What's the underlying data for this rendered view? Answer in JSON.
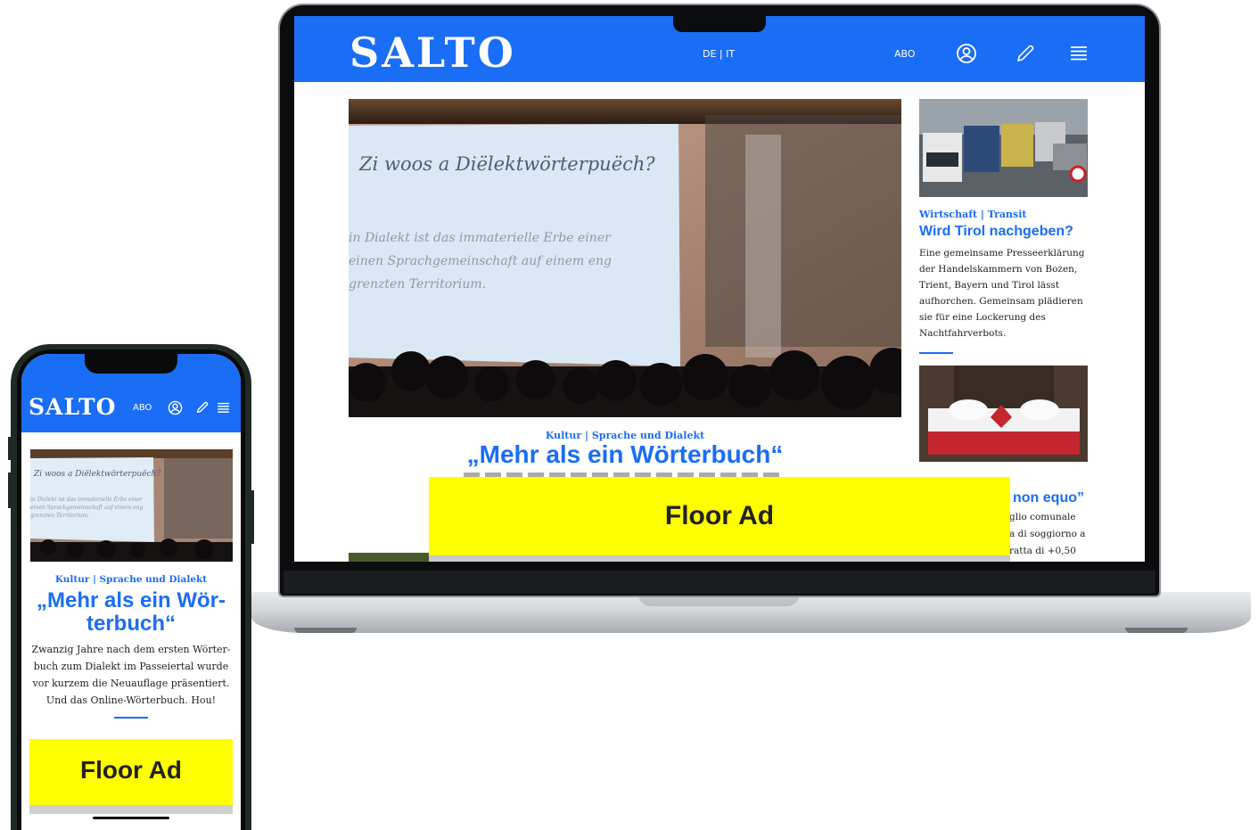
{
  "laptop": {
    "header": {
      "logo": "SALTO",
      "lang_switch": "DE | IT",
      "abo_label": "ABO",
      "icons": [
        "user-icon",
        "pencil-icon",
        "menu-icon"
      ],
      "bg_color": "#1a6df5"
    },
    "main_article": {
      "slide_title": "Zi woos a Diëlektwörterpuëch?",
      "slide_lines": [
        "in Dialekt ist das immaterielle Erbe einer",
        "einen Sprachgemeinschaft auf einem eng",
        "grenzten Territorium."
      ],
      "kicker": "Kultur | Sprache und Dialekt",
      "headline": "„Mehr als ein Wörterbuch“"
    },
    "side_article_1": {
      "kicker": "Wirtschaft | Transit",
      "title": "Wird Tirol nachgeben?",
      "text": "Eine gemeinsame Presseerklärung der Handelskammern von Bozen, Trient, Bayern und Tirol lässt aufhorchen. Gemeinsam plädieren sie für eine Lockerung des Nachtfahrverbots."
    },
    "side_article_2": {
      "title_fragment": "non equo”",
      "text_fragments": [
        "glio comunale",
        "a di soggiorno a",
        "ratta di +0,50"
      ]
    },
    "floor_ad": {
      "label": "Floor Ad",
      "color": "#ffff00"
    }
  },
  "phone": {
    "header": {
      "logo": "SALTO",
      "abo_label": "ABO",
      "icons": [
        "user-icon",
        "pencil-icon",
        "menu-icon"
      ]
    },
    "article": {
      "slide_title": "Zi woos a Diëlektwörterpuëch?",
      "slide_lines": [
        "in Dialekt ist das immaterielle Erbe einer",
        "einen Sprachgemeinschaft auf einem eng",
        "grenzten Territorium."
      ],
      "kicker": "Kultur | Sprache und Dialekt",
      "headline": "„Mehr als ein Wör-terbuch“",
      "teaser": "Zwanzig Jahre nach dem ersten Wörter-buch zum Dialekt im Passeiertal wurde vor kurzem die Neuauflage präsentiert. Und das Online-Wörterbuch. Hou!"
    },
    "floor_ad": {
      "label": "Floor Ad",
      "color": "#ffff00"
    }
  }
}
